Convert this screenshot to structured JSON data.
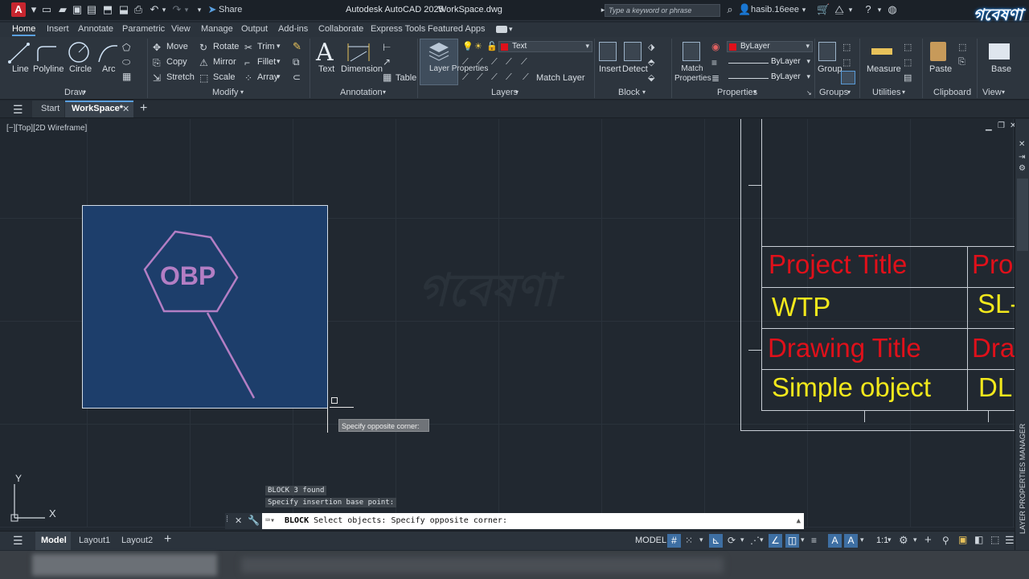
{
  "titlebar": {
    "app_title": "Autodesk AutoCAD 2025",
    "file_name": "WorkSpace.dwg",
    "share_label": "Share",
    "search_placeholder": "Type a keyword or phrase",
    "user_name": "hasib.16eee",
    "app_letter": "A"
  },
  "ribbon_tabs": [
    "Home",
    "Insert",
    "Annotate",
    "Parametric",
    "View",
    "Manage",
    "Output",
    "Add-ins",
    "Collaborate",
    "Express Tools",
    "Featured Apps"
  ],
  "ribbon": {
    "draw": {
      "title": "Draw",
      "line": "Line",
      "polyline": "Polyline",
      "circle": "Circle",
      "arc": "Arc"
    },
    "modify": {
      "title": "Modify",
      "move": "Move",
      "rotate": "Rotate",
      "trim": "Trim",
      "copy": "Copy",
      "mirror": "Mirror",
      "fillet": "Fillet",
      "stretch": "Stretch",
      "scale": "Scale",
      "array": "Array"
    },
    "annotation": {
      "title": "Annotation",
      "text": "Text",
      "dimension": "Dimension",
      "table": "Table"
    },
    "layers": {
      "title": "Layers",
      "layer_properties": "Layer Properties",
      "current_layer": "Text",
      "match_layer": "Match Layer"
    },
    "block": {
      "title": "Block",
      "insert": "Insert",
      "detect": "Detect"
    },
    "properties": {
      "title": "Properties",
      "match_properties": "Match Properties",
      "color": "ByLayer",
      "linetype": "ByLayer",
      "lineweight": "ByLayer"
    },
    "groups": {
      "title": "Groups",
      "group": "Group"
    },
    "utilities": {
      "title": "Utilities",
      "measure": "Measure"
    },
    "clipboard": {
      "title": "Clipboard",
      "paste": "Paste"
    },
    "view": {
      "title": "View",
      "base": "Base"
    }
  },
  "doc_tabs": {
    "start": "Start",
    "workspace": "WorkSpace*"
  },
  "viewport_label": "[−][Top][2D Wireframe]",
  "drawing": {
    "hexagon_text": "OBP",
    "table": {
      "row1": [
        "Project  Title",
        "Pro"
      ],
      "row2": [
        "WTP",
        "SL-"
      ],
      "row3": [
        "Drawing  Title",
        "Dra"
      ],
      "row4": [
        "Simple object",
        "DL"
      ]
    }
  },
  "tooltip": "Specify opposite corner:",
  "command_history": [
    "BLOCK 3 found",
    "Specify insertion base point:"
  ],
  "command_line": {
    "command": "BLOCK",
    "prompt": "Select objects: Specify opposite corner:"
  },
  "ucs": {
    "x": "X",
    "y": "Y"
  },
  "status": {
    "model_tab": "Model",
    "layout1": "Layout1",
    "layout2": "Layout2",
    "model_space": "MODEL",
    "scale": "1:1"
  },
  "side_panel_label": "LAYER PROPERTIES MANAGER",
  "colors": {
    "accent": "#5aa0e0",
    "selection_fill": "#1d3e6b",
    "table_red": "#e0101a",
    "table_yellow": "#f2e81c",
    "logo_red": "#c7262f"
  }
}
